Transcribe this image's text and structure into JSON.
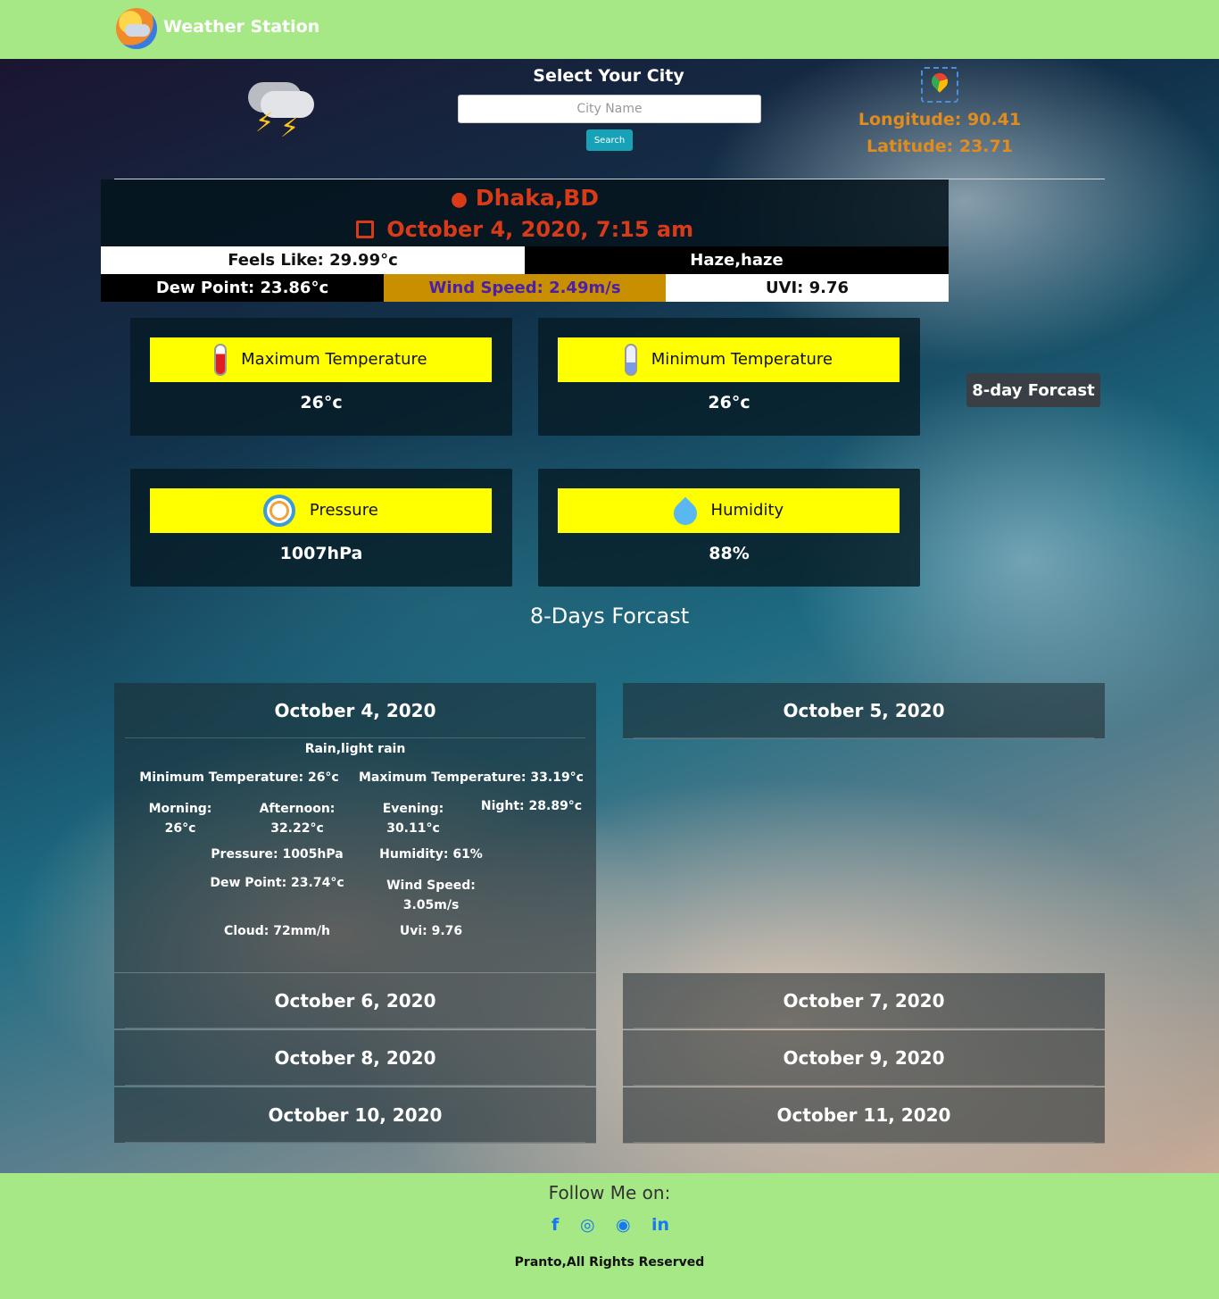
{
  "app": {
    "title": "Weather Station"
  },
  "search": {
    "title": "Select Your City",
    "placeholder": "City Name",
    "button": "Search"
  },
  "coords": {
    "longitude": "Longitude: 90.41",
    "latitude": "Latitude: 23.71"
  },
  "location": {
    "city": "Dhaka,BD",
    "datetime": "October 4, 2020, 7:15 am"
  },
  "current": {
    "feels_like": "Feels Like: 29.99°c",
    "condition": "Haze,haze",
    "dew_point": "Dew Point: 23.86°c",
    "wind_speed": "Wind Speed: 2.49m/s",
    "uvi": "UVI: 9.76"
  },
  "cards": {
    "max_temp": {
      "label": "Maximum Temperature",
      "value": "26°c"
    },
    "min_temp": {
      "label": "Minimum Temperature",
      "value": "26°c"
    },
    "pressure": {
      "label": "Pressure",
      "value": "1007hPa"
    },
    "humidity": {
      "label": "Humidity",
      "value": "88%"
    }
  },
  "forecast_button": "8-day Forcast",
  "forecast_title": "8-Days Forcast",
  "days": [
    {
      "date": "October 4, 2020"
    },
    {
      "date": "October 5, 2020"
    },
    {
      "date": "October 6, 2020"
    },
    {
      "date": "October 7, 2020"
    },
    {
      "date": "October 8, 2020"
    },
    {
      "date": "October 9, 2020"
    },
    {
      "date": "October 10, 2020"
    },
    {
      "date": "October 11, 2020"
    }
  ],
  "day1": {
    "desc": "Rain,light rain",
    "min": "Minimum Temperature: 26°c",
    "max": "Maximum Temperature: 33.19°c",
    "morning_label": "Morning:",
    "morning": "26°c",
    "afternoon_label": "Afternoon:",
    "afternoon": "32.22°c",
    "evening_label": "Evening:",
    "evening": "30.11°c",
    "night": "Night: 28.89°c",
    "pressure": "Pressure: 1005hPa",
    "humidity": "Humidity: 61%",
    "dew": "Dew Point: 23.74°c",
    "wind_label": "Wind Speed:",
    "wind": "3.05m/s",
    "cloud": "Cloud: 72mm/h",
    "uvi": "Uvi: 9.76"
  },
  "footer": {
    "follow": "Follow Me on:",
    "social": {
      "facebook": "f",
      "instagram": "◎",
      "github": "◉",
      "linkedin": "in"
    },
    "rights": "Pranto,All Rights Reserved"
  },
  "colors": {
    "navbar": "#a6e886",
    "accent_orange": "#e08c1e",
    "location_red": "#d93a17",
    "card_bar": "#ffff00",
    "wind_bg": "#c88f00",
    "wind_text": "#4b1fa8",
    "search_btn": "#17a2b8",
    "social": "#1877f2"
  },
  "icons": {
    "brand": "weather-logo-icon",
    "weather": "thunderstorm-icon",
    "map": "map-pin-icon",
    "max_temp": "thermometer-hot-icon",
    "min_temp": "thermometer-cold-icon",
    "pressure": "gauge-icon",
    "humidity": "droplet-icon"
  }
}
